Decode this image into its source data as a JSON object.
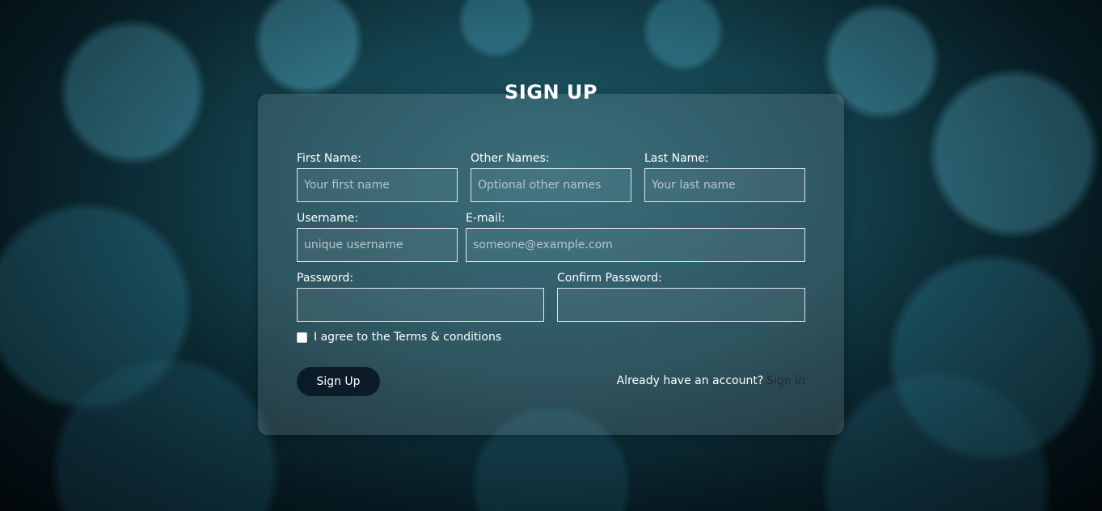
{
  "form": {
    "title": "SIGN UP",
    "fields": {
      "first_name": {
        "label": "First Name:",
        "placeholder": "Your first name",
        "value": ""
      },
      "other_names": {
        "label": "Other Names:",
        "placeholder": "Optional other names",
        "value": ""
      },
      "last_name": {
        "label": "Last Name:",
        "placeholder": "Your last name",
        "value": ""
      },
      "username": {
        "label": "Username:",
        "placeholder": "unique username",
        "value": ""
      },
      "email": {
        "label": "E-mail:",
        "placeholder": "someone@example.com",
        "value": ""
      },
      "password": {
        "label": "Password:",
        "placeholder": "",
        "value": ""
      },
      "confirm_password": {
        "label": "Confirm Password:",
        "placeholder": "",
        "value": ""
      }
    },
    "terms_label": "I agree to the Terms & conditions",
    "terms_checked": false,
    "submit_label": "Sign Up",
    "signin_prompt": "Already have an account?",
    "signin_link": "Sign in"
  },
  "colors": {
    "button_bg": "#0b1c28",
    "signin_link": "#1a2b36",
    "background": "#123d49"
  }
}
